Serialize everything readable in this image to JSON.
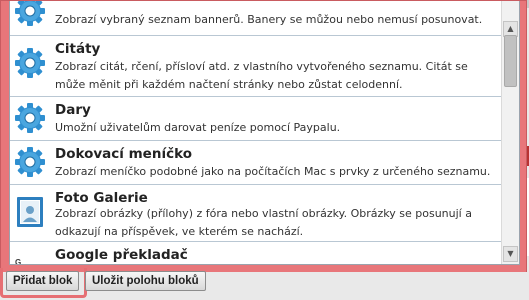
{
  "blocks": [
    {
      "title": "",
      "icon": "gear-icon",
      "desc": "Zobrazí vybraný seznam bannerů. Banery se můžou nebo nemusí posunovat."
    },
    {
      "title": "Citáty",
      "icon": "gear-icon",
      "desc": "Zobrazí citát, rčení, přísloví atd. z vlastního vytvořeného seznamu. Citát se může měnit při každém načtení stránky nebo zůstat celodenní."
    },
    {
      "title": "Dary",
      "icon": "gear-icon",
      "desc": "Umožní uživatelům darovat peníze pomocí Paypalu."
    },
    {
      "title": "Dokovací meníčko",
      "icon": "gear-icon",
      "desc": "Zobrazí meníčko podobné jako na počítačích Mac s prvky z určeného seznamu."
    },
    {
      "title": "Foto Galerie",
      "icon": "photo-frame-icon",
      "desc": "Zobrazí obrázky (přílohy) z fóra nebo vlastní obrázky. Obrázky se posunují a odkazují na příspěvek, ve kterém se nachází."
    },
    {
      "title": "Google překladač",
      "icon": "google-icon",
      "desc": ""
    }
  ],
  "footer": {
    "add_block": "Přidat blok",
    "save_positions": "Uložit polohu bloků"
  },
  "colors": {
    "popup_border": "#e8767a",
    "gear_blue": "#2f8fd0"
  }
}
